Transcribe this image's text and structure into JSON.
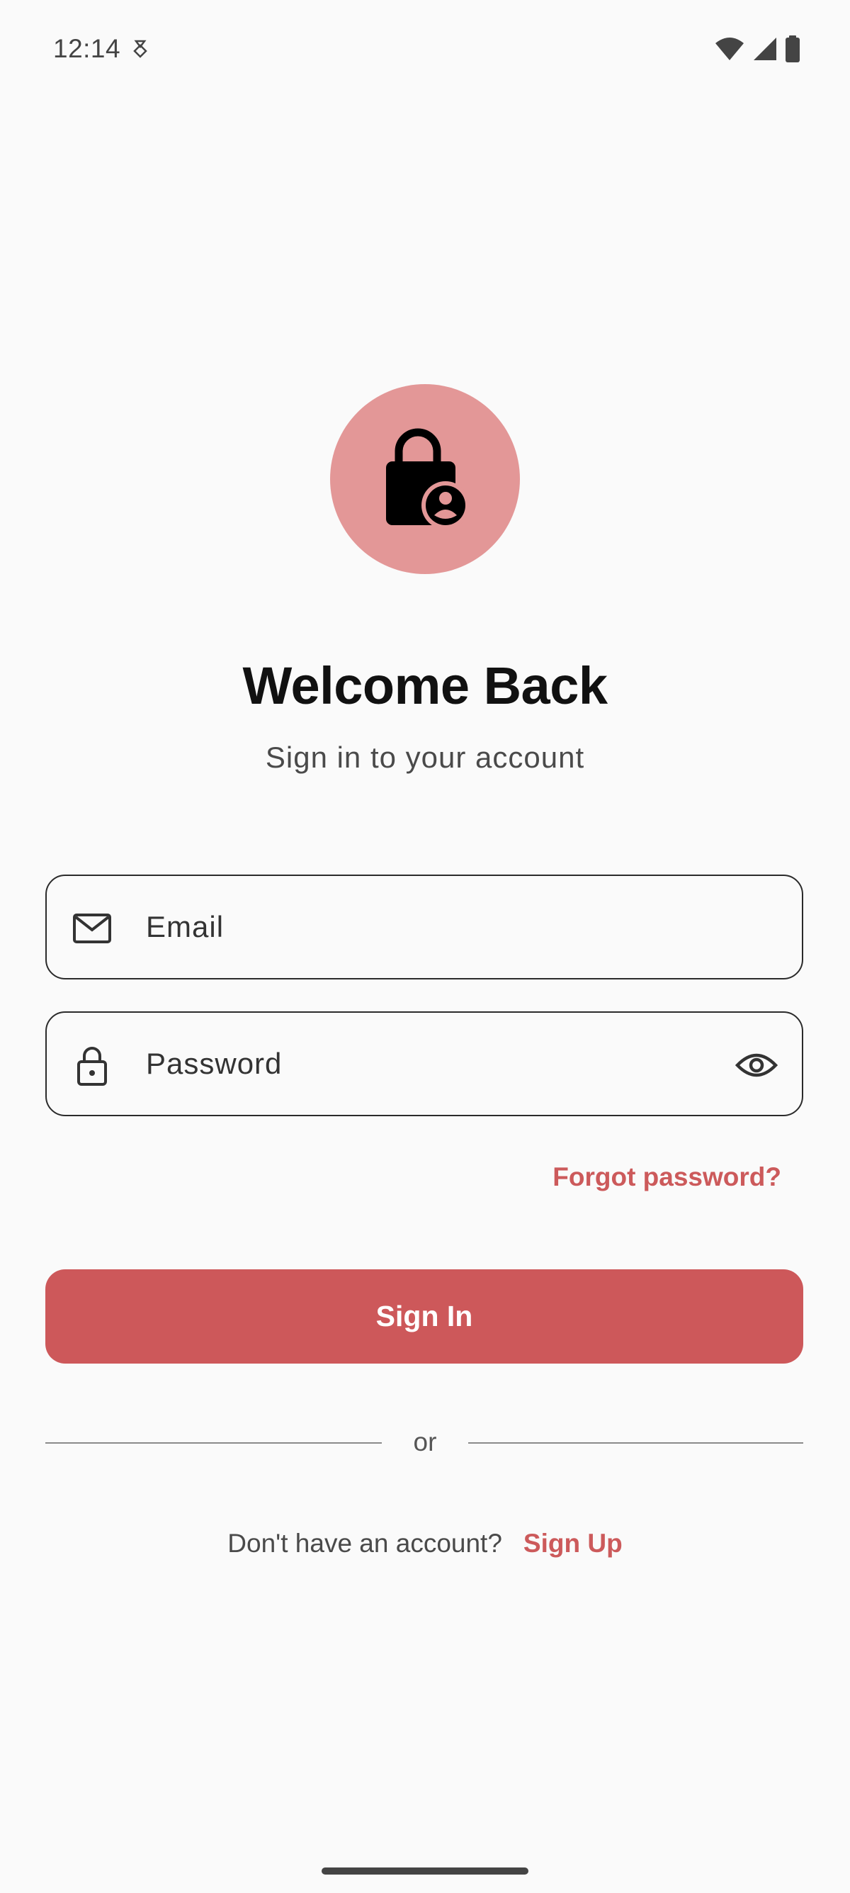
{
  "status_bar": {
    "time": "12:14",
    "icons": [
      "wifi-icon",
      "signal-icon",
      "battery-icon"
    ]
  },
  "header": {
    "logo_icon": "lock-person-icon",
    "title": "Welcome Back",
    "subtitle": "Sign in to your account"
  },
  "form": {
    "email_label": "Email",
    "email_icon": "mail-icon",
    "password_label": "Password",
    "password_icon": "lock-icon",
    "visibility_icon": "eye-icon",
    "forgot_password": "Forgot password?",
    "sign_in_label": "Sign In"
  },
  "divider": {
    "text": "or"
  },
  "footer": {
    "prompt": "Don't have an account?",
    "sign_up_label": "Sign Up"
  },
  "colors": {
    "accent": "#cd585a",
    "logo_bg": "#e39797",
    "background": "#fafafa"
  }
}
